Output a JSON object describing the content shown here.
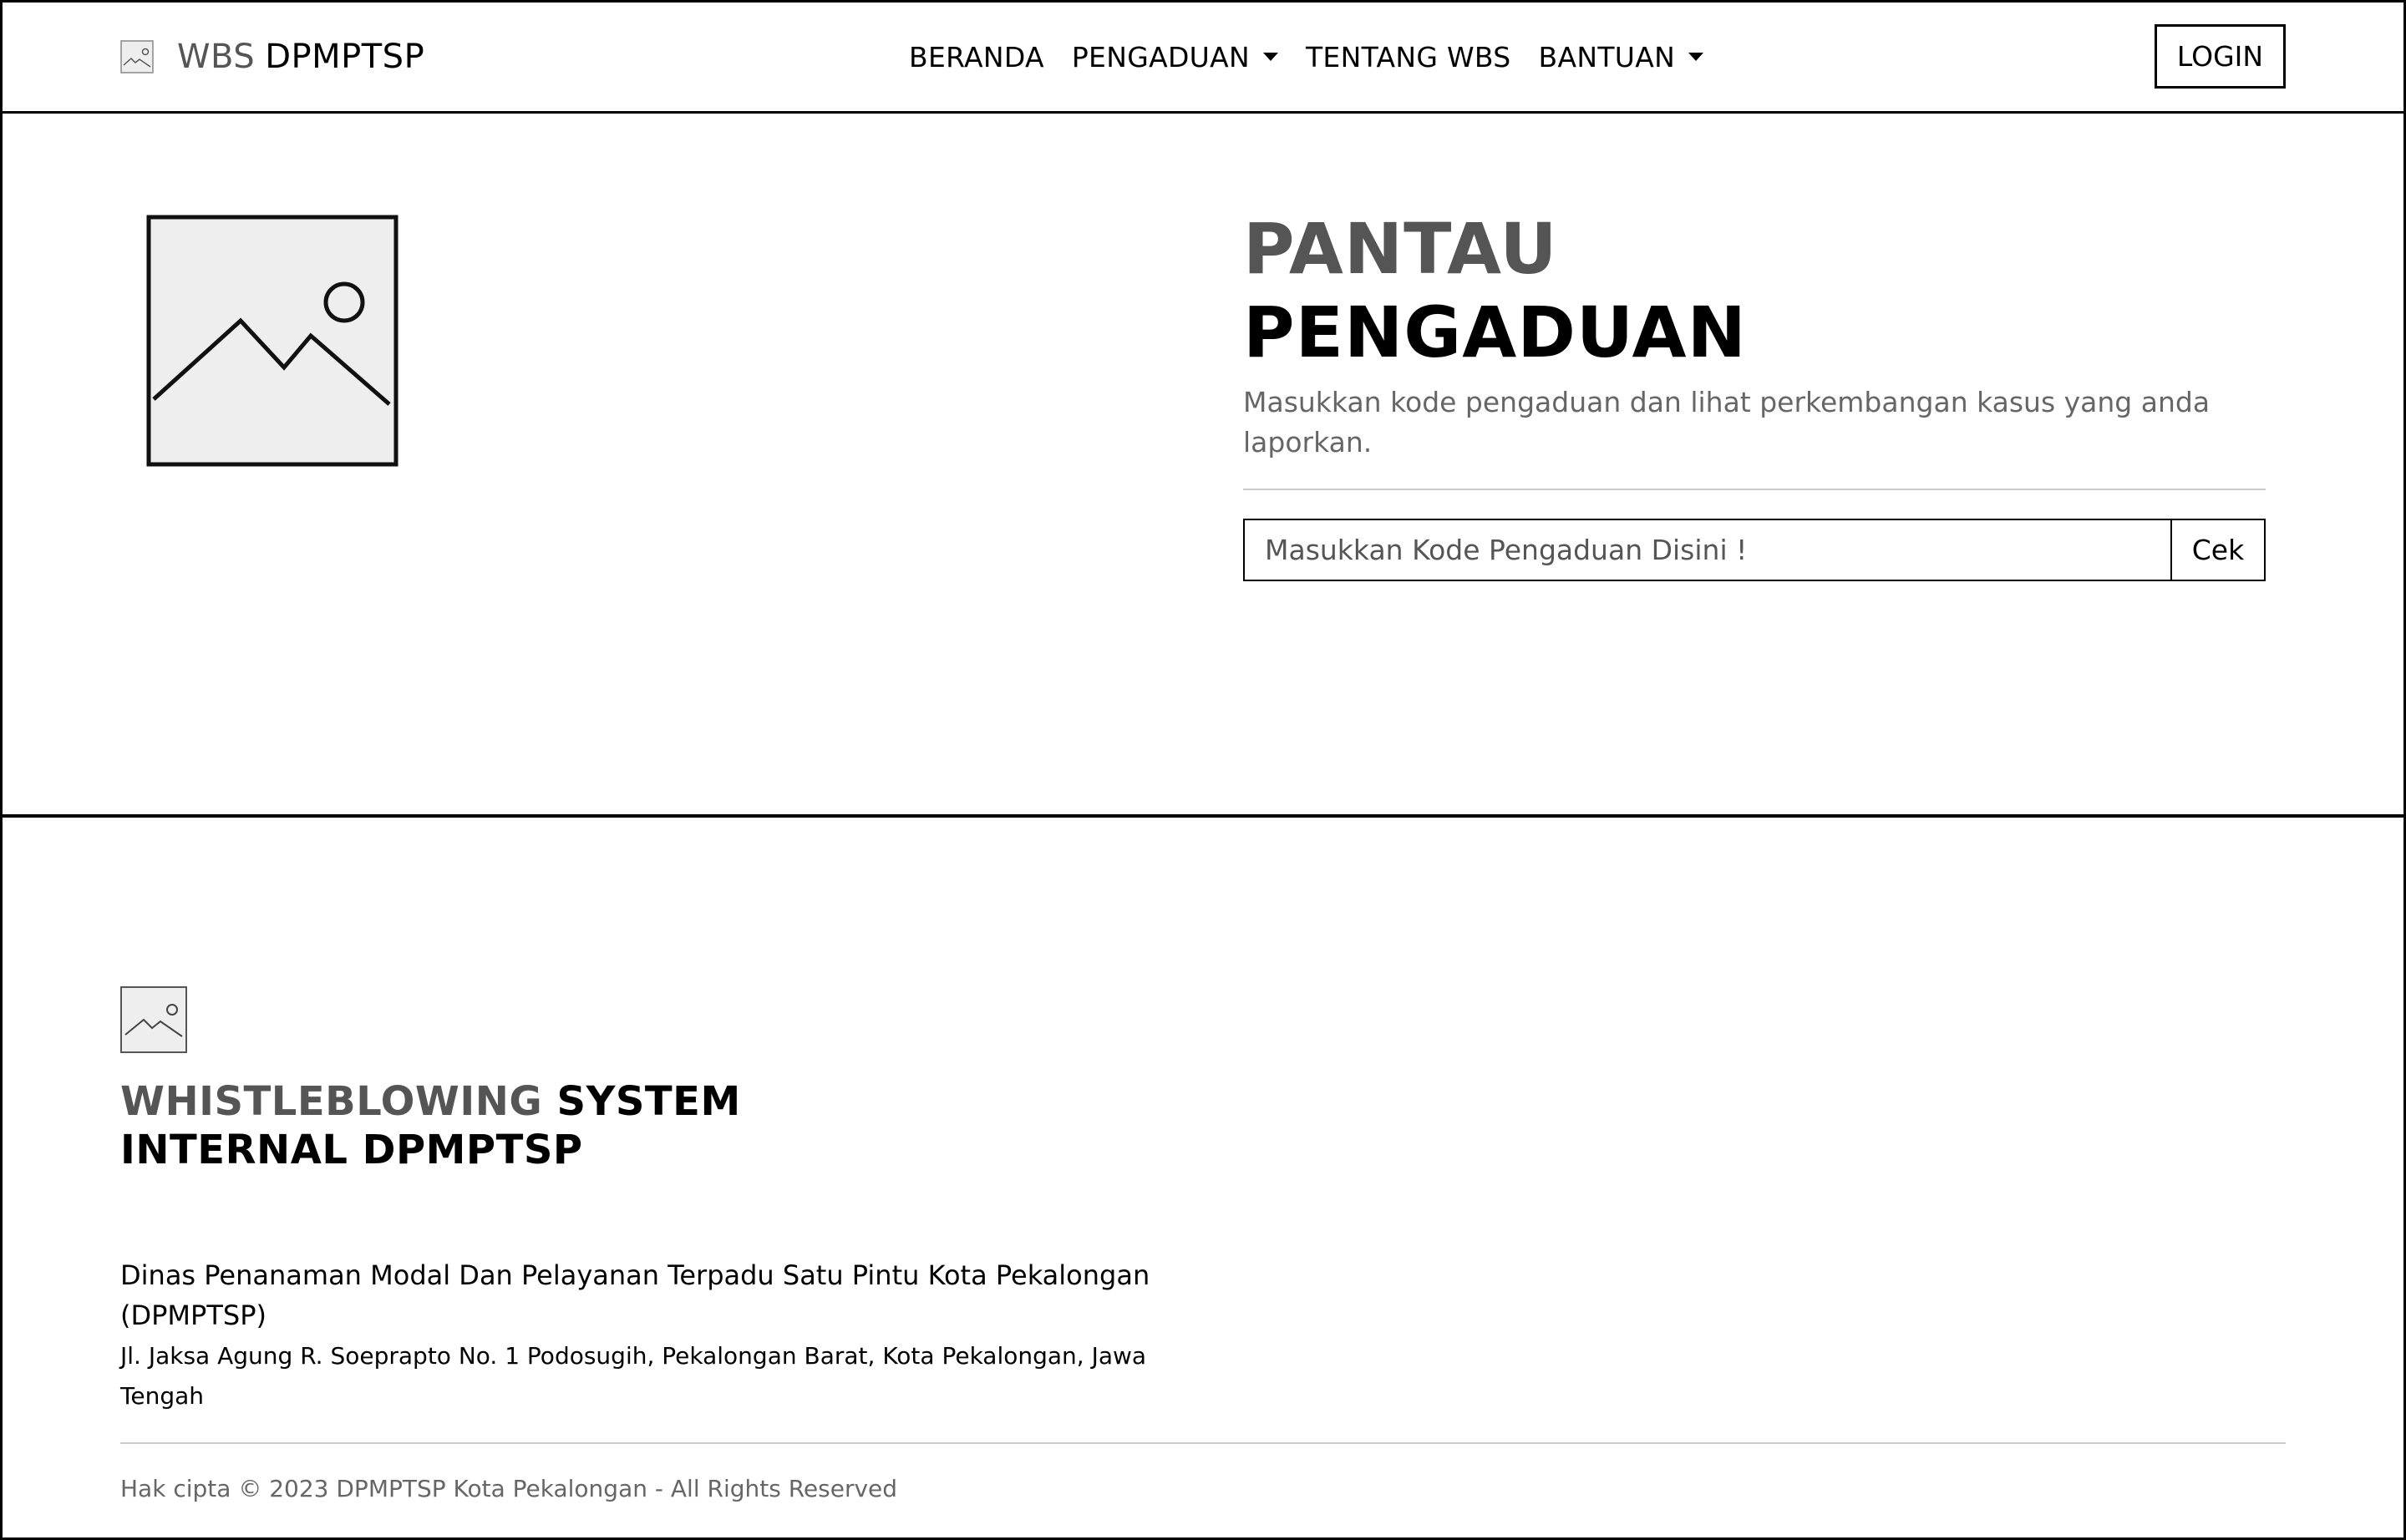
{
  "navbar": {
    "brand_prefix": "WBS",
    "brand_name": "DPMPTSP",
    "items": [
      {
        "label": "BERANDA",
        "dropdown": false
      },
      {
        "label": "PENGADUAN",
        "dropdown": true
      },
      {
        "label": "TENTANG WBS",
        "dropdown": false
      },
      {
        "label": "BANTUAN",
        "dropdown": true
      }
    ],
    "login_label": "LOGIN"
  },
  "hero": {
    "title_line1": "PANTAU",
    "title_line2": "PENGADUAN",
    "description": "Masukkan kode pengaduan dan lihat perkembangan kasus yang anda laporkan.",
    "search_placeholder": "Masukkan Kode Pengaduan Disini !",
    "search_value": "",
    "check_label": "Cek"
  },
  "footer": {
    "title_grey": "WHISTLEBLOWING",
    "title_dark_1": "SYSTEM",
    "title_dark_2": "INTERNAL DPMPTSP",
    "org_name": "Dinas Penanaman Modal Dan Pelayanan Terpadu Satu Pintu Kota Pekalongan (DPMPTSP)",
    "address": "Jl. Jaksa Agung R. Soeprapto No. 1 Podosugih, Pekalongan Barat, Kota Pekalongan, Jawa Tengah",
    "copyright": "Hak cipta © 2023 DPMPTSP Kota Pekalongan - All Rights Reserved"
  },
  "icons": {
    "brand_logo": "image-placeholder-icon",
    "hero_image": "image-placeholder-icon",
    "footer_logo": "image-placeholder-icon",
    "dropdown": "caret-down-icon"
  }
}
